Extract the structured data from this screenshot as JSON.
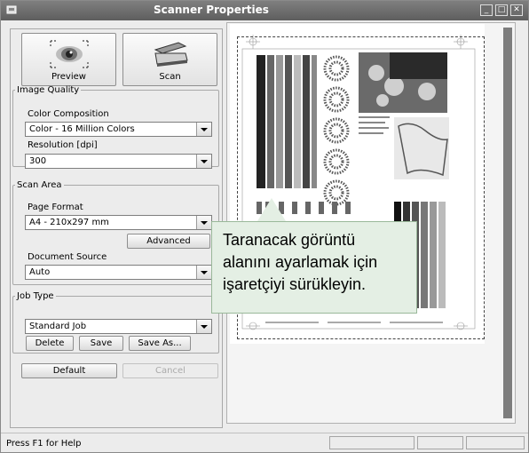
{
  "window": {
    "title": "Scanner Properties",
    "title_color": "#5e5e5e"
  },
  "toolbar": {
    "preview_label": "Preview",
    "scan_label": "Scan"
  },
  "image_quality": {
    "legend": "Image Quality",
    "color_composition_label": "Color Composition",
    "color_composition_value": "Color - 16 Million Colors",
    "resolution_label": "Resolution [dpi]",
    "resolution_value": "300"
  },
  "scan_area": {
    "legend": "Scan Area",
    "page_format_label": "Page Format",
    "page_format_value": "A4 - 210x297 mm",
    "advanced_label": "Advanced",
    "document_source_label": "Document Source",
    "document_source_value": "Auto"
  },
  "job_type": {
    "legend": "Job Type",
    "value": "Standard Job",
    "delete_label": "Delete",
    "save_label": "Save",
    "save_as_label": "Save As..."
  },
  "footer": {
    "default_label": "Default",
    "cancel_label": "Cancel"
  },
  "callout": {
    "line1": "Taranacak görüntü",
    "line2": "alanını ayarlamak için",
    "line3": "işaretçiyi sürükleyin.",
    "bg_color": "#e4efe4"
  },
  "statusbar": {
    "message": "Press F1 for Help"
  }
}
